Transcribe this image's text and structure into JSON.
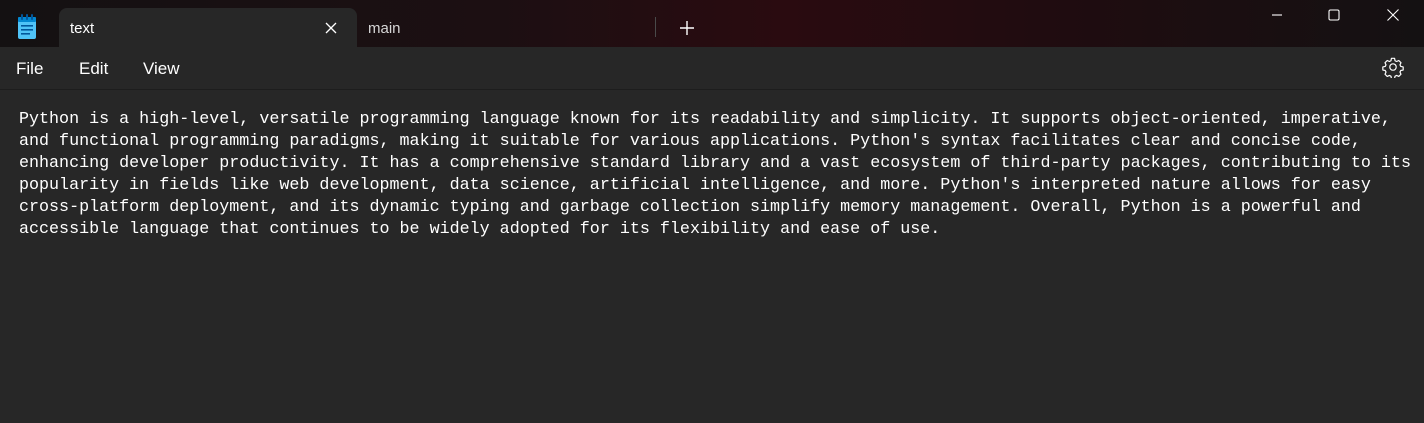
{
  "tabs": [
    {
      "label": "text",
      "active": true
    },
    {
      "label": "main",
      "active": false
    }
  ],
  "menu": {
    "file": "File",
    "edit": "Edit",
    "view": "View"
  },
  "icons": {
    "app": "notepad-icon",
    "tab_close": "close-icon",
    "new_tab": "plus-icon",
    "minimize": "minimize-icon",
    "maximize": "maximize-icon",
    "close": "close-icon",
    "settings": "gear-icon"
  },
  "colors": {
    "background": "#272727",
    "text": "#ffffff",
    "titlebar_accent": "#2a0b10",
    "app_icon": "#4fc3f7"
  },
  "document": {
    "lines": [
      "Python is a high-level, versatile programming language known for its readability and simplicity. It supports object-oriented, imperative,",
      "and functional programming paradigms, making it suitable for various applications. Python's syntax facilitates clear and concise code,",
      "enhancing developer productivity. It has a comprehensive standard library and a vast ecosystem of third-party packages, contributing to its",
      "popularity in fields like web development, data science, artificial intelligence, and more. Python's interpreted nature allows for easy",
      "cross-platform deployment, and its dynamic typing and garbage collection simplify memory management. Overall, Python is a powerful and",
      "accessible language that continues to be widely adopted for its flexibility and ease of use."
    ]
  }
}
